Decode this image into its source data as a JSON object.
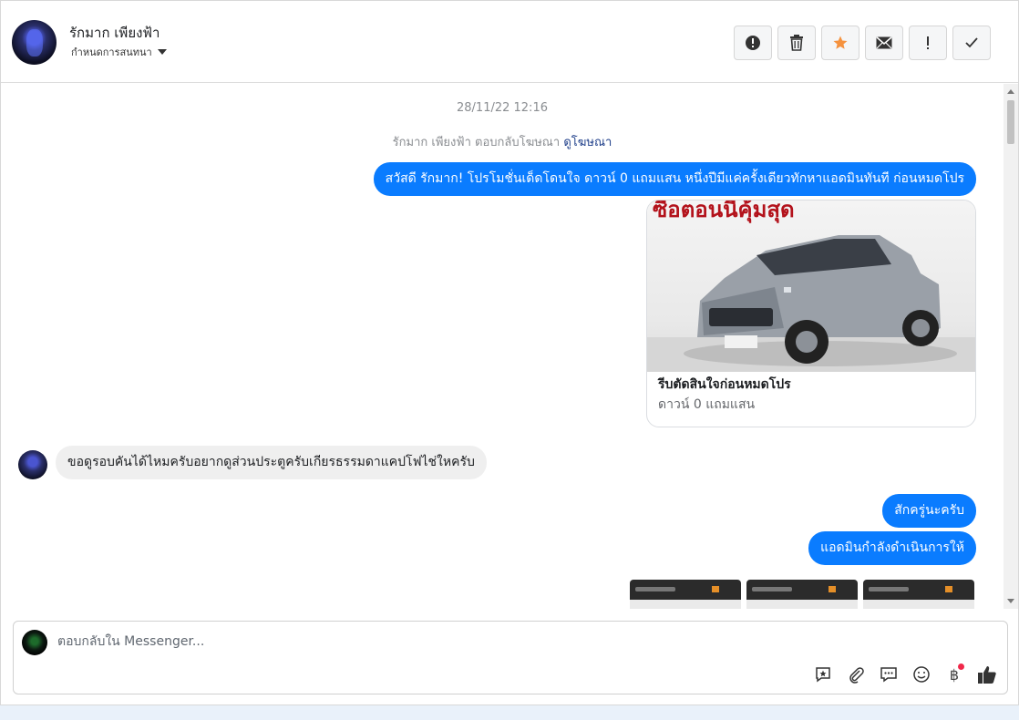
{
  "header": {
    "contact_name": "รักมาก เพียงฟ้า",
    "assign_label": "กำหนดการสนทนา",
    "actions": [
      {
        "name": "mark-spam-button",
        "icon": "alert-circle-icon"
      },
      {
        "name": "delete-button",
        "icon": "trash-icon"
      },
      {
        "name": "star-button",
        "icon": "star-icon"
      },
      {
        "name": "mark-unread-button",
        "icon": "mail-icon"
      },
      {
        "name": "follow-up-button",
        "icon": "exclamation-icon"
      },
      {
        "name": "mark-done-button",
        "icon": "check-icon"
      }
    ]
  },
  "chat": {
    "timestamp": "28/11/22 12:16",
    "ad_reply_text": "รักมาก เพียงฟ้า ตอบกลับโฆษณา",
    "ad_reply_link": "ดูโฆษณา",
    "messages": [
      {
        "direction": "out",
        "text": "สวัสดี รักมาก! โปรโมชั่นเด็ดโดนใจ ดาวน์ 0 แถมแสน หนึ่งปีมีแค่ครั้งเดียวทักหาแอดมินทันที ก่อนหมดโปร"
      },
      {
        "direction": "in",
        "text": "ขอดูรอบคันได้ไหมครับอยากดูส่วนประตูครับเกียรธรรมดาแคปโฟไช่ใหครับ"
      },
      {
        "direction": "out",
        "text": "สักครู่นะครับ"
      },
      {
        "direction": "out",
        "text": "แอดมินกำลังดำเนินการให้"
      }
    ],
    "card": {
      "image_text": "ซื้อตอนนี้คุ้มสุด",
      "title": "รีบตัดสินใจก่อนหมดโปร",
      "subtitle": "ดาวน์ 0 แถมแสน"
    }
  },
  "composer": {
    "placeholder": "ตอบกลับใน Messenger...",
    "tools": [
      "saved-reply-icon",
      "attach-icon",
      "chat-bubbles-icon",
      "emoji-icon",
      "baht-icon",
      "thumbs-up-icon"
    ],
    "baht_symbol": "฿"
  },
  "colors": {
    "brand_blue": "#0a7cff",
    "star_orange": "#f5923e",
    "badge_red": "#f0284a"
  }
}
